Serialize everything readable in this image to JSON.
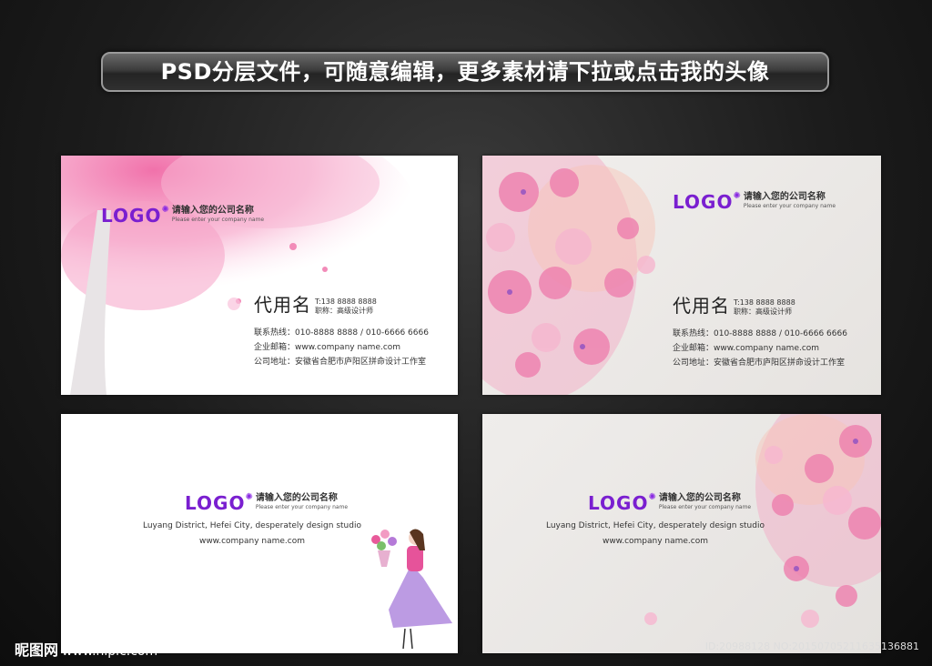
{
  "banner": "PSD分层文件，可随意编辑，更多素材请下拉或点击我的头像",
  "card": {
    "logo_word": "LOGO",
    "logo_cn": "请输入您的公司名称",
    "logo_en": "Please enter your company name",
    "name": "代用名",
    "phone": "T:138 8888 8888",
    "job": "职称：高级设计师",
    "contact": "联系热线：010-8888 8888 / 010-6666 6666",
    "email": "企业邮箱：www.company name.com",
    "address": "公司地址：安徽省合肥市庐阳区拼命设计工作室",
    "address_en": "Luyang District, Hefei City, desperately design studio",
    "website": "www.company name.com"
  },
  "watermark": {
    "site_cn": "昵图网",
    "site_url": "www.nipic.com",
    "id_text": "ID:20988128 NO:20150705211635136881"
  },
  "colors": {
    "accent": "#7a1fd0",
    "blossom": "#f28bb8"
  }
}
